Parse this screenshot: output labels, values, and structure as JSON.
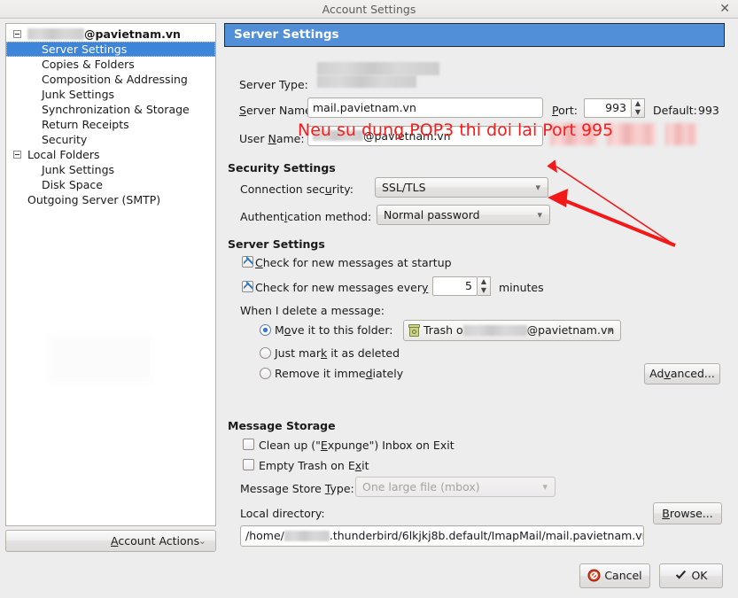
{
  "window": {
    "title": "Account Settings",
    "close_label": "✕"
  },
  "sidebar": {
    "items": [
      {
        "label": "@pavietnam.vn",
        "redacted_prefix": true,
        "level": 0,
        "bold": true,
        "twisty": true,
        "selected": false
      },
      {
        "label": "Server Settings",
        "level": 1,
        "bold": false,
        "twisty": false,
        "selected": true
      },
      {
        "label": "Copies & Folders",
        "level": 1,
        "bold": false,
        "twisty": false,
        "selected": false
      },
      {
        "label": "Composition & Addressing",
        "level": 1,
        "bold": false,
        "twisty": false,
        "selected": false
      },
      {
        "label": "Junk Settings",
        "level": 1,
        "bold": false,
        "twisty": false,
        "selected": false
      },
      {
        "label": "Synchronization & Storage",
        "level": 1,
        "bold": false,
        "twisty": false,
        "selected": false
      },
      {
        "label": "Return Receipts",
        "level": 1,
        "bold": false,
        "twisty": false,
        "selected": false
      },
      {
        "label": "Security",
        "level": 1,
        "bold": false,
        "twisty": false,
        "selected": false
      },
      {
        "label": "Local Folders",
        "level": 0,
        "bold": false,
        "twisty": true,
        "selected": false
      },
      {
        "label": "Junk Settings",
        "level": 1,
        "bold": false,
        "twisty": false,
        "selected": false
      },
      {
        "label": "Disk Space",
        "level": 1,
        "bold": false,
        "twisty": false,
        "selected": false
      },
      {
        "label": "Outgoing Server (SMTP)",
        "level": 0,
        "bold": false,
        "twisty": false,
        "selected": false
      }
    ],
    "account_actions": {
      "label": "Account Actions",
      "chevron": "⌄"
    }
  },
  "pane": {
    "header": "Server Settings",
    "server_type": {
      "label": "Server Type:",
      "value": ""
    },
    "server_name": {
      "label": "Server Name:",
      "value": "mail.pavietnam.vn"
    },
    "port": {
      "label": "Port:",
      "value": "993"
    },
    "port_default": {
      "label": "Default:",
      "value": "993"
    },
    "user_name": {
      "label": "User Name:",
      "value": "@pavietnam.vn"
    },
    "security_settings": {
      "header": "Security Settings",
      "connection_security": {
        "label": "Connection security:",
        "value": "SSL/TLS"
      },
      "authentication_method": {
        "label": "Authentication method:",
        "value": "Normal password"
      }
    },
    "server_settings": {
      "header": "Server Settings",
      "check_startup": {
        "label": "Check for new messages at startup",
        "checked": true
      },
      "check_every": {
        "label": "Check for new messages every",
        "checked": true,
        "value": "5",
        "suffix": "minutes"
      },
      "delete_label": "When I delete a message:",
      "delete_options": [
        {
          "label": "Move it to this folder:",
          "selected": true
        },
        {
          "label": "Just mark it as deleted",
          "selected": false
        },
        {
          "label": "Remove it immediately",
          "selected": false
        }
      ],
      "trash_folder": {
        "prefix": "Trash o",
        "suffix": "@pavietnam.vn",
        "icon": "trash-icon",
        "chevron": "⌄"
      },
      "advanced_button": "Advanced..."
    },
    "message_storage": {
      "header": "Message Storage",
      "expunge": {
        "label": "Clean up (\"Expunge\") Inbox on Exit",
        "checked": false
      },
      "empty_trash": {
        "label": "Empty Trash on Exit",
        "checked": false
      },
      "store_type": {
        "label": "Message Store Type:",
        "value": "One large file (mbox)",
        "disabled": true
      },
      "local_directory": {
        "label": "Local directory:",
        "value_prefix": "/home/",
        "value_suffix": ".thunderbird/6lkjkj8b.default/ImapMail/mail.pavietnam.vn",
        "browse_button": "Browse..."
      }
    }
  },
  "footer": {
    "cancel": "Cancel",
    "ok": "OK"
  },
  "annotation": {
    "text": "Neu su dung POP3 thi doi lai Port 995",
    "color": "#fa1c1c"
  },
  "colors": {
    "header_blue": "#5190d8",
    "selection_blue": "#3d85d8",
    "window_bg": "#ededed",
    "annotation_red": "#fa1c1c"
  }
}
